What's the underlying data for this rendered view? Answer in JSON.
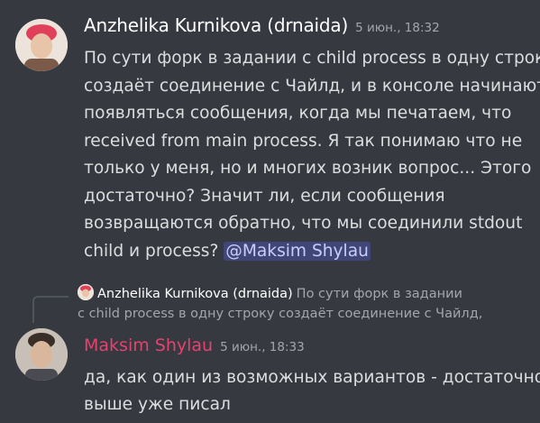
{
  "messages": [
    {
      "author": "Anzhelika Kurnikova (drnaida)",
      "timestamp": "5 июн., 18:32",
      "lines": [
        "По сути форк в задании с child process в одну строку",
        "создаёт соединение с Чайлд, и в консоле начинают",
        "появляться сообщения, когда мы печатаем, что",
        "received from main process. Я так понимаю что не",
        "только у меня, но и многих возник вопрос... Этого",
        "достаточно? Значит ли, если сообщения",
        "возвращаются обратно, что мы соединили stdout"
      ],
      "last_line_text": "child и process? ",
      "mention": "@Maksim Shylau"
    },
    {
      "reply": {
        "author": "Anzhelika Kurnikova (drnaida)",
        "preview_line1": "По сути форк в задании",
        "preview_line2": "с child process в одну строку создаёт соединение с Чайлд,"
      },
      "author": "Maksim Shylau",
      "author_color": "#e6416f",
      "timestamp": "5 июн., 18:33",
      "lines": [
        "да, как один из возможных вариантов - достаточно,",
        "выше уже писал"
      ]
    }
  ],
  "colors": {
    "background": "#36393f",
    "text": "#dcddde",
    "muted": "#a3a6aa",
    "mention_bg": "#3f4576"
  }
}
